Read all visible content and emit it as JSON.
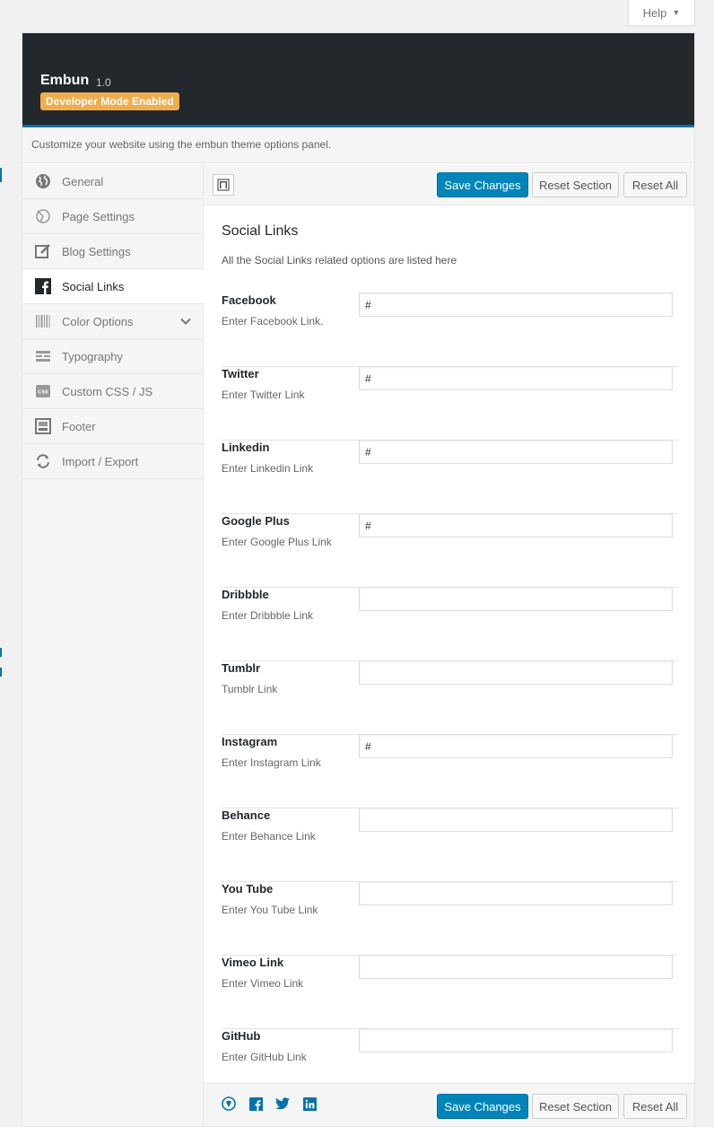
{
  "help": {
    "label": "Help"
  },
  "header": {
    "name": "Embun",
    "version": "1.0",
    "badge": "Developer Mode Enabled",
    "subtitle": "Customize your website using the embun theme options panel."
  },
  "sidebar": {
    "items": [
      {
        "label": "General",
        "icon": "globe-icon"
      },
      {
        "label": "Page Settings",
        "icon": "page-settings-icon"
      },
      {
        "label": "Blog Settings",
        "icon": "edit-icon"
      },
      {
        "label": "Social Links",
        "icon": "facebook-icon",
        "active": true
      },
      {
        "label": "Color Options",
        "icon": "barcode-icon",
        "has_children": true
      },
      {
        "label": "Typography",
        "icon": "typography-icon"
      },
      {
        "label": "Custom CSS / JS",
        "icon": "css-icon"
      },
      {
        "label": "Footer",
        "icon": "footer-icon"
      },
      {
        "label": "Import / Export",
        "icon": "refresh-icon"
      }
    ]
  },
  "toolbar": {
    "save_label": "Save Changes",
    "reset_section_label": "Reset Section",
    "reset_all_label": "Reset All"
  },
  "section": {
    "title": "Social Links",
    "description": "All the Social Links related options are listed here"
  },
  "fields": [
    {
      "label": "Facebook",
      "sub": "Enter Facebook Link.",
      "value": "#"
    },
    {
      "label": "Twitter",
      "sub": "Enter Twitter Link",
      "value": "#"
    },
    {
      "label": "Linkedin",
      "sub": "Enter Linkedin Link",
      "value": "#"
    },
    {
      "label": "Google Plus",
      "sub": "Enter Google Plus Link",
      "value": "#"
    },
    {
      "label": "Dribbble",
      "sub": "Enter Dribbble Link",
      "value": ""
    },
    {
      "label": "Tumblr",
      "sub": "Tumblr Link",
      "value": ""
    },
    {
      "label": "Instagram",
      "sub": "Enter Instagram Link",
      "value": "#"
    },
    {
      "label": "Behance",
      "sub": "Enter Behance Link",
      "value": ""
    },
    {
      "label": "You Tube",
      "sub": "Enter You Tube Link",
      "value": ""
    },
    {
      "label": "Vimeo Link",
      "sub": "Enter Vimeo Link",
      "value": ""
    },
    {
      "label": "GitHub",
      "sub": "Enter GitHub Link",
      "value": ""
    }
  ],
  "footer_icons": [
    "redux-icon",
    "facebook-icon",
    "twitter-icon",
    "linkedin-icon"
  ],
  "colors": {
    "header_bg": "#23282d",
    "accent": "#0073aa",
    "primary_button": "#0085ba",
    "badge": "#f0ad4e"
  }
}
